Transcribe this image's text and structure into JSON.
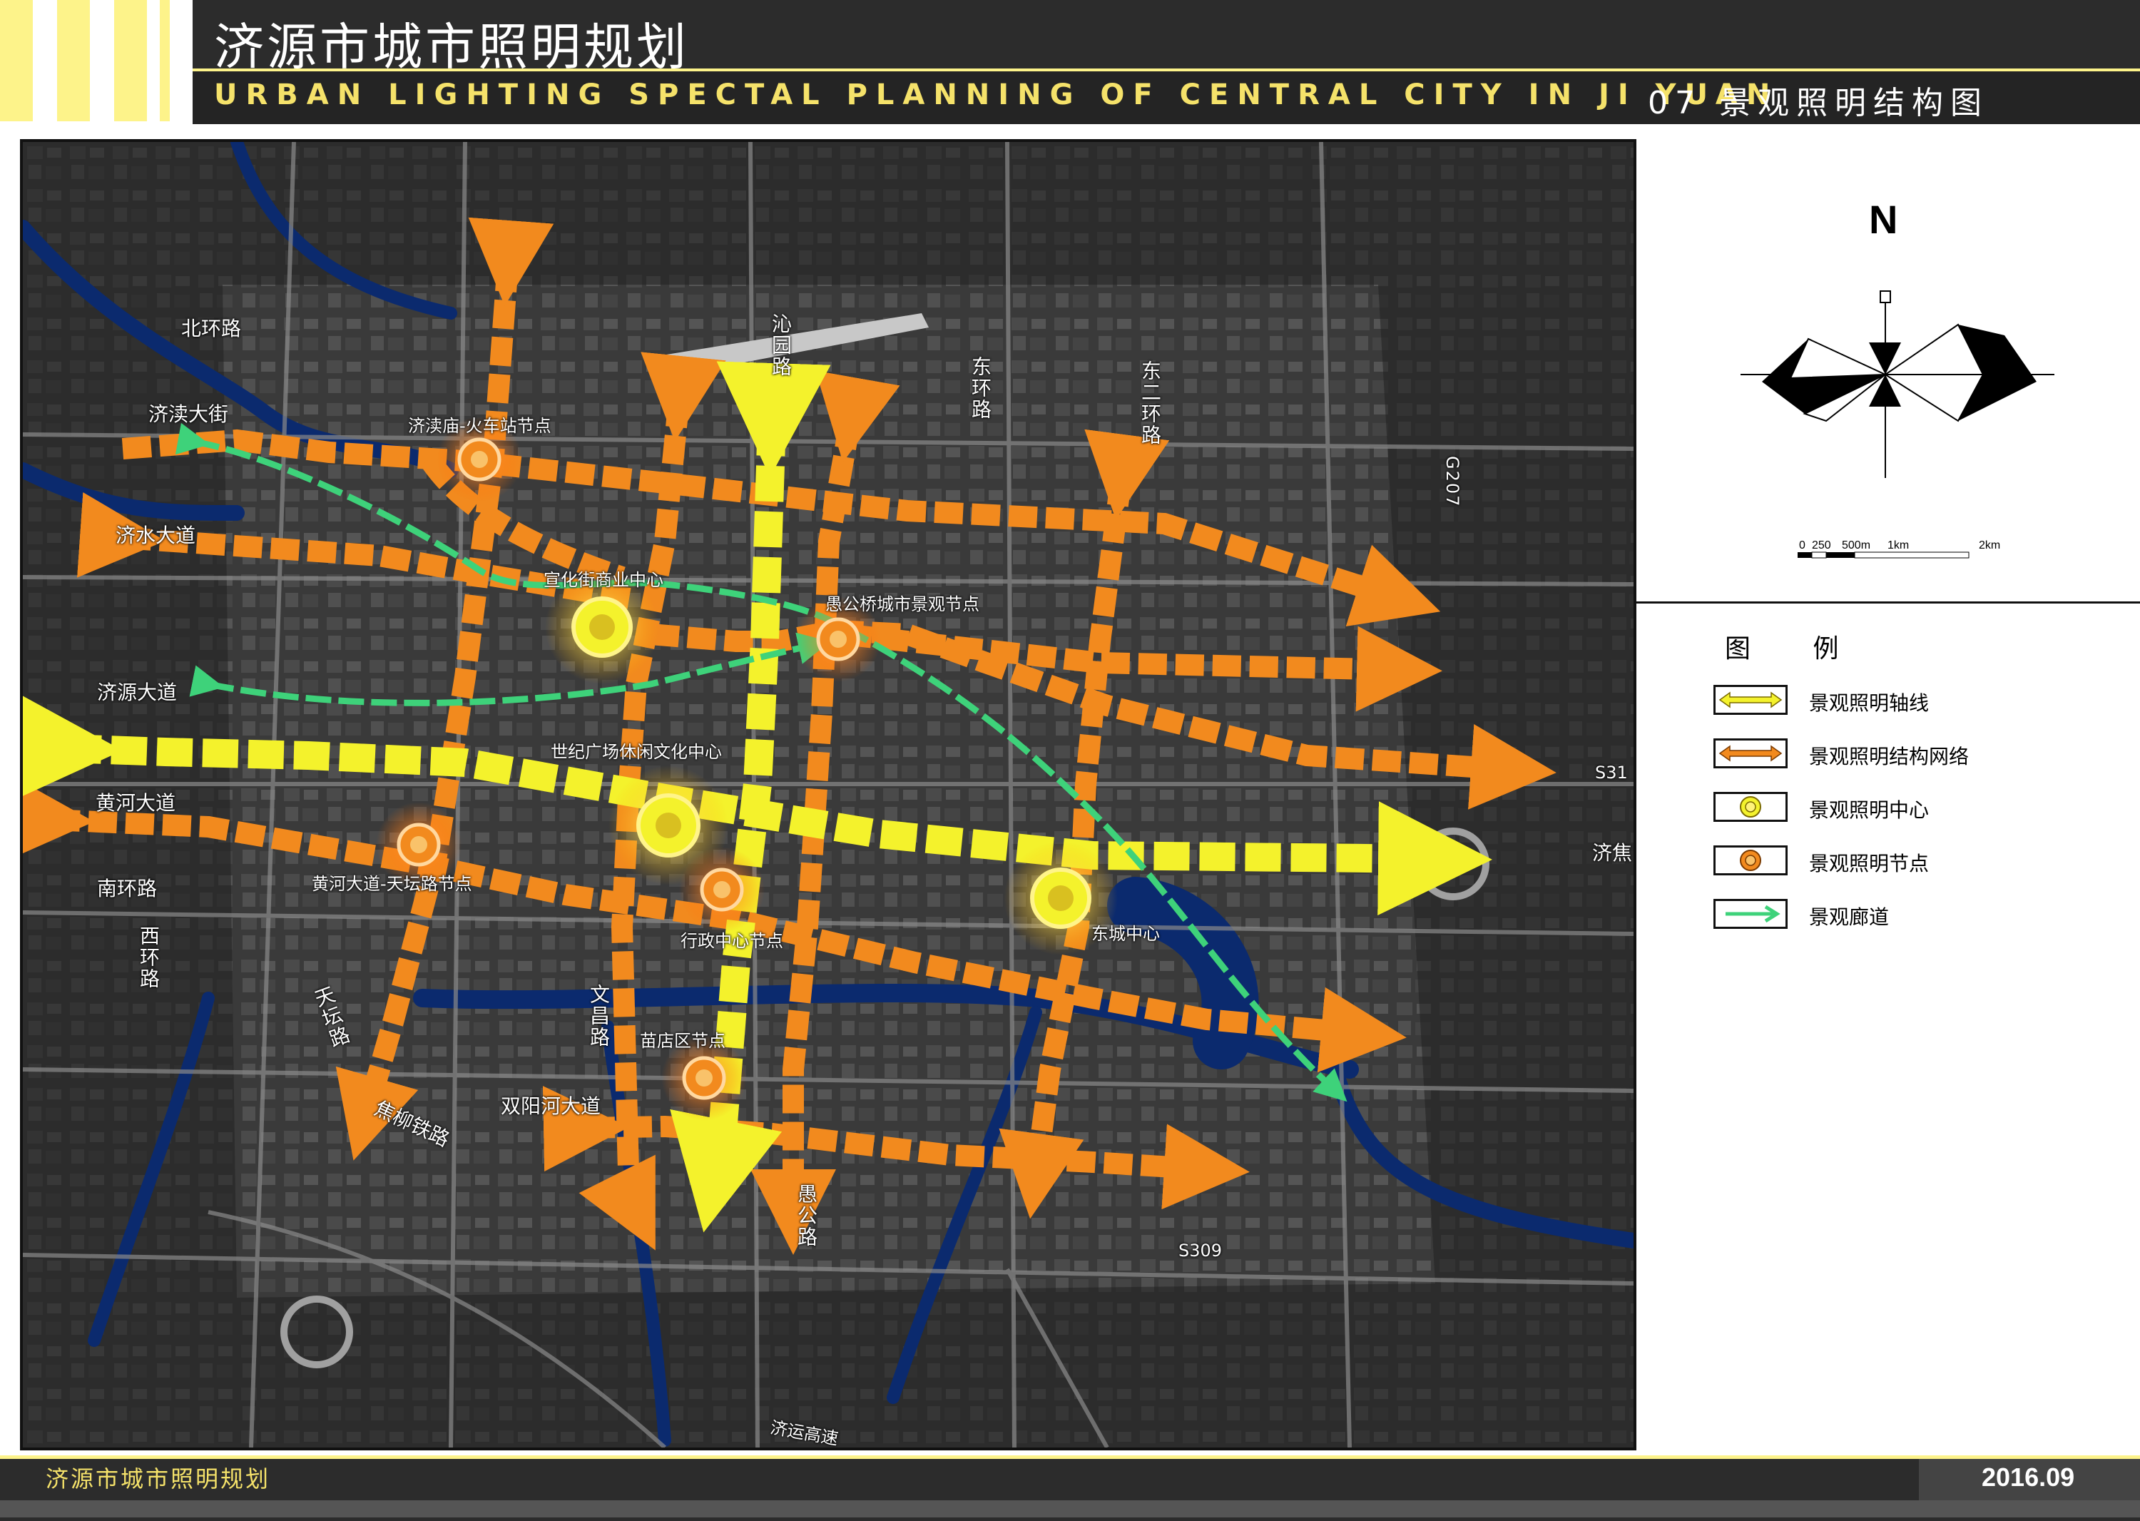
{
  "header": {
    "title": "济源市城市照明规划",
    "subtitle": "URBAN LIGHTING SPECTAL PLANNING OF CENTRAL CITY IN JI YUAN",
    "sheet_title": "07 景观照明结构图"
  },
  "legend": {
    "north": "N",
    "scale": [
      "0",
      "250",
      "500m",
      "1km",
      "2km"
    ],
    "title": "图 例",
    "items": [
      {
        "label": "景观照明轴线",
        "color": "#f4f22c"
      },
      {
        "label": "景观照明结构网络",
        "color": "#f28a1e"
      },
      {
        "label": "景观照明中心",
        "color": "#f4f22c"
      },
      {
        "label": "景观照明节点",
        "color": "#f28a1e"
      },
      {
        "label": "景观廊道",
        "color": "#3ed27a"
      }
    ]
  },
  "map": {
    "roads": [
      "北环路",
      "济渎大街",
      "济水大道",
      "济源大道",
      "黄河大道",
      "南环路",
      "西环路",
      "天坛路",
      "焦柳铁路",
      "双阳河大道",
      "文昌路",
      "沁园路",
      "愚公路",
      "东环路",
      "东二环路",
      "G207",
      "S309",
      "S31",
      "济焦",
      "济运高速"
    ],
    "nodes": [
      {
        "label": "济渎庙-火车站节点",
        "type": "node"
      },
      {
        "label": "宣化街商业中心",
        "type": "center"
      },
      {
        "label": "愚公桥城市景观节点",
        "type": "node"
      },
      {
        "label": "世纪广场休闲文化中心",
        "type": "center"
      },
      {
        "label": "黄河大道-天坛路节点",
        "type": "node"
      },
      {
        "label": "行政中心节点",
        "type": "node"
      },
      {
        "label": "东城中心",
        "type": "center"
      },
      {
        "label": "苗店区节点",
        "type": "node"
      }
    ],
    "colors": {
      "axis": "#f4f22c",
      "network": "#f28a1e",
      "corridor": "#3ed27a",
      "water": "#0b2a6e",
      "base": "#3b3b3b"
    }
  },
  "footer": {
    "title": "济源市城市照明规划",
    "date": "2016.09"
  }
}
